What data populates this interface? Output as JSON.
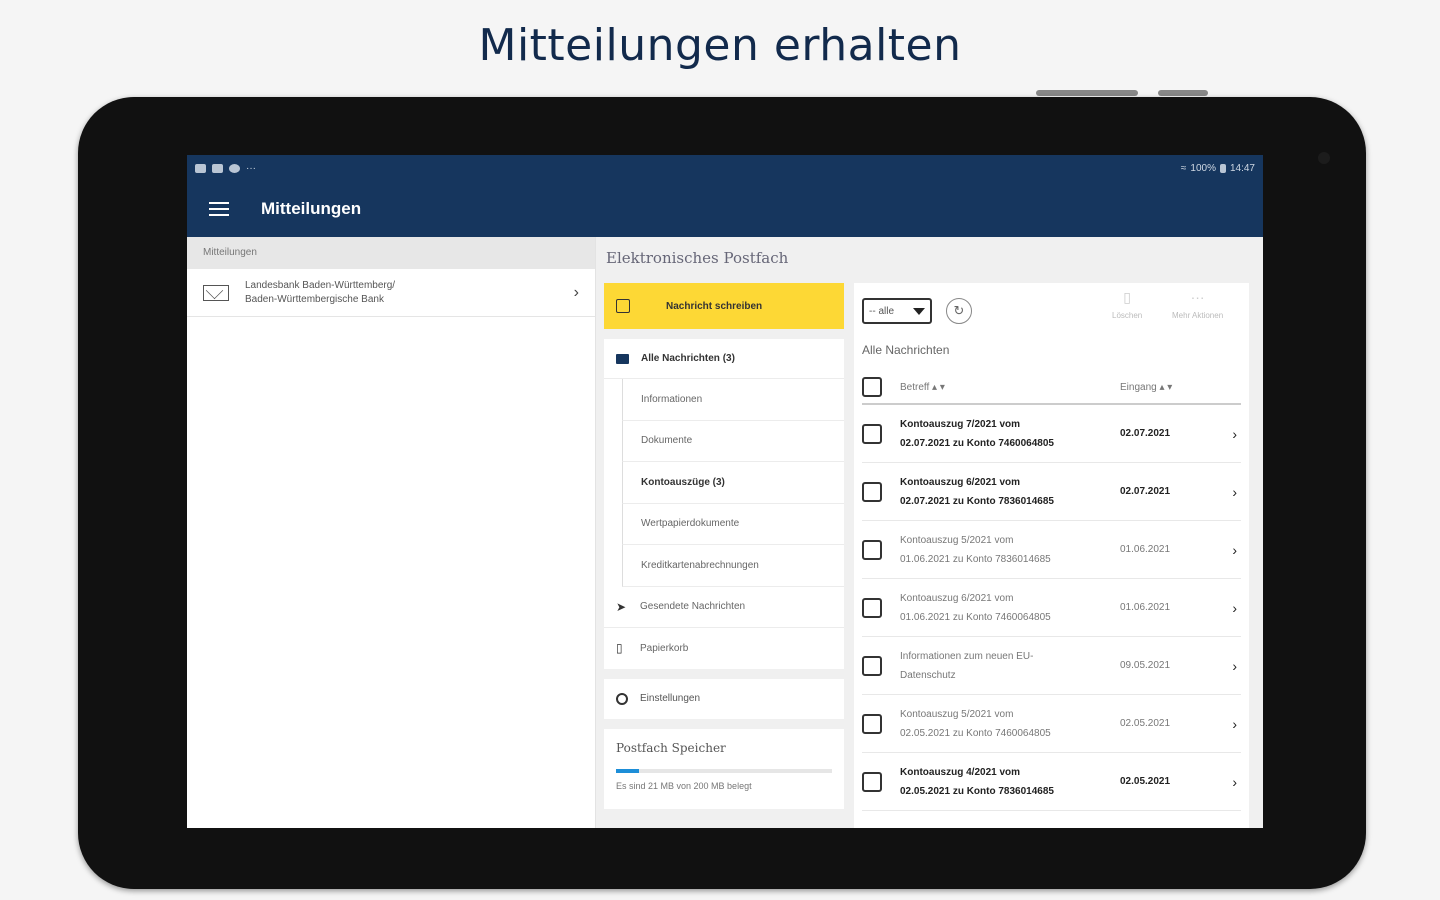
{
  "headline": "Mitteilungen erhalten",
  "status_bar": {
    "left_icons": [
      "image-icon",
      "play-store-icon",
      "settings-icon",
      "more-icon"
    ],
    "more": "···",
    "right_text": "100%",
    "time": "14:47"
  },
  "appbar": {
    "title": "Mitteilungen"
  },
  "left_pane": {
    "header": "Mitteilungen",
    "items": [
      {
        "line1": "Landesbank Baden-Württemberg/",
        "line2": "Baden-Württembergische Bank"
      }
    ]
  },
  "postfach": {
    "title": "Elektronisches Postfach",
    "write_button": "Nachricht schreiben",
    "all_messages": "Alle Nachrichten (3)",
    "subfolders": [
      "Informationen",
      "Dokumente",
      "Kontoauszüge (3)",
      "Wertpapierdokumente",
      "Kreditkartenabrechnungen"
    ],
    "sent": "Gesendete Nachrichten",
    "trash": "Papierkorb",
    "settings": "Einstellungen",
    "storage": {
      "title": "Postfach Speicher",
      "text": "Es sind 21 MB von 200 MB belegt",
      "used_fraction": 0.105
    }
  },
  "list": {
    "filter_value": "-- alle",
    "delete_label": "Löschen",
    "more_label": "Mehr Aktionen",
    "title": "Alle Nachrichten",
    "col_subject": "Betreff",
    "col_date": "Eingang",
    "rows": [
      {
        "line1": "Kontoauszug 7/2021 vom",
        "line2": "02.07.2021 zu Konto 7460064805",
        "date": "02.07.2021",
        "unread": true
      },
      {
        "line1": "Kontoauszug 6/2021 vom",
        "line2": "02.07.2021 zu Konto 7836014685",
        "date": "02.07.2021",
        "unread": true
      },
      {
        "line1": "Kontoauszug 5/2021 vom",
        "line2": "01.06.2021 zu Konto 7836014685",
        "date": "01.06.2021",
        "unread": false
      },
      {
        "line1": "Kontoauszug 6/2021 vom",
        "line2": "01.06.2021 zu Konto 7460064805",
        "date": "01.06.2021",
        "unread": false
      },
      {
        "line1": "Informationen zum neuen EU-",
        "line2": "Datenschutz",
        "date": "09.05.2021",
        "unread": false
      },
      {
        "line1": "Kontoauszug 5/2021 vom",
        "line2": "02.05.2021 zu Konto 7460064805",
        "date": "02.05.2021",
        "unread": false
      },
      {
        "line1": "Kontoauszug 4/2021 vom",
        "line2": "02.05.2021 zu Konto 7836014685",
        "date": "02.05.2021",
        "unread": true
      }
    ]
  },
  "colors": {
    "navy": "#16365e",
    "accent_yellow": "#fdd835",
    "progress_blue": "#1d8ed8"
  }
}
